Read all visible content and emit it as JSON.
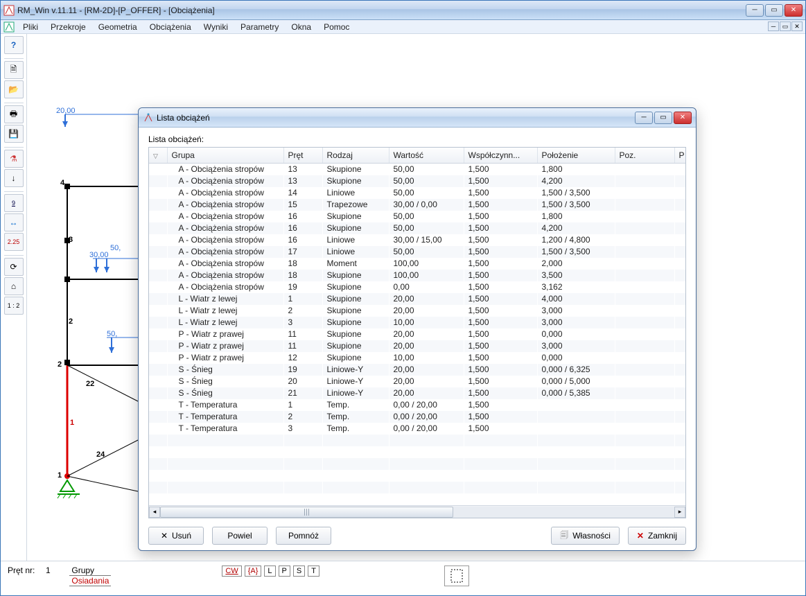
{
  "window": {
    "title": "RM_Win v.11.11 - [RM-2D]-[P_OFFER] - [Obciążenia]"
  },
  "menu": [
    "Pliki",
    "Przekroje",
    "Geometria",
    "Obciążenia",
    "Wyniki",
    "Parametry",
    "Okna",
    "Pomoc"
  ],
  "toolbar_left": {
    "help": "?",
    "num_label": "9",
    "dim_label": "2.25",
    "ratio_label": "1 : 2"
  },
  "canvas_labels": {
    "n20": "20,00",
    "n50a": "50,",
    "n30": "30,00",
    "n50b": "50,",
    "node1": "1",
    "node2": "2",
    "node3": "3",
    "node4": "4",
    "mem1": "1",
    "mem22": "22",
    "mem24": "24"
  },
  "dialog": {
    "title": "Lista obciążeń",
    "subtitle": "Lista obciążeń:",
    "columns": [
      "Grupa",
      "Pręt",
      "Rodzaj",
      "Wartość",
      "Współczynn...",
      "Położenie",
      "Poz.",
      "P"
    ],
    "rows": [
      {
        "grupa": "A - Obciążenia stropów",
        "pret": "13",
        "rodzaj": "Skupione",
        "wartosc": "50,00",
        "wsp": "1,500",
        "polozenie": "1,800",
        "poz": ""
      },
      {
        "grupa": "A - Obciążenia stropów",
        "pret": "13",
        "rodzaj": "Skupione",
        "wartosc": "50,00",
        "wsp": "1,500",
        "polozenie": "4,200",
        "poz": ""
      },
      {
        "grupa": "A - Obciążenia stropów",
        "pret": "14",
        "rodzaj": "Liniowe",
        "wartosc": "50,00",
        "wsp": "1,500",
        "polozenie": "1,500 / 3,500",
        "poz": ""
      },
      {
        "grupa": "A - Obciążenia stropów",
        "pret": "15",
        "rodzaj": "Trapezowe",
        "wartosc": "30,00 / 0,00",
        "wsp": "1,500",
        "polozenie": "1,500 / 3,500",
        "poz": ""
      },
      {
        "grupa": "A - Obciążenia stropów",
        "pret": "16",
        "rodzaj": "Skupione",
        "wartosc": "50,00",
        "wsp": "1,500",
        "polozenie": "1,800",
        "poz": ""
      },
      {
        "grupa": "A - Obciążenia stropów",
        "pret": "16",
        "rodzaj": "Skupione",
        "wartosc": "50,00",
        "wsp": "1,500",
        "polozenie": "4,200",
        "poz": ""
      },
      {
        "grupa": "A - Obciążenia stropów",
        "pret": "16",
        "rodzaj": "Liniowe",
        "wartosc": "30,00 / 15,00",
        "wsp": "1,500",
        "polozenie": "1,200 / 4,800",
        "poz": ""
      },
      {
        "grupa": "A - Obciążenia stropów",
        "pret": "17",
        "rodzaj": "Liniowe",
        "wartosc": "50,00",
        "wsp": "1,500",
        "polozenie": "1,500 / 3,500",
        "poz": ""
      },
      {
        "grupa": "A - Obciążenia stropów",
        "pret": "18",
        "rodzaj": "Moment",
        "wartosc": "100,00",
        "wsp": "1,500",
        "polozenie": "2,000",
        "poz": ""
      },
      {
        "grupa": "A - Obciążenia stropów",
        "pret": "18",
        "rodzaj": "Skupione",
        "wartosc": "100,00",
        "wsp": "1,500",
        "polozenie": "3,500",
        "poz": ""
      },
      {
        "grupa": "A - Obciążenia stropów",
        "pret": "19",
        "rodzaj": "Skupione",
        "wartosc": "0,00",
        "wsp": "1,500",
        "polozenie": "3,162",
        "poz": ""
      },
      {
        "grupa": "L - Wiatr z lewej",
        "pret": "1",
        "rodzaj": "Skupione",
        "wartosc": "20,00",
        "wsp": "1,500",
        "polozenie": "4,000",
        "poz": ""
      },
      {
        "grupa": "L - Wiatr z lewej",
        "pret": "2",
        "rodzaj": "Skupione",
        "wartosc": "20,00",
        "wsp": "1,500",
        "polozenie": "3,000",
        "poz": ""
      },
      {
        "grupa": "L - Wiatr z lewej",
        "pret": "3",
        "rodzaj": "Skupione",
        "wartosc": "10,00",
        "wsp": "1,500",
        "polozenie": "3,000",
        "poz": ""
      },
      {
        "grupa": "P - Wiatr z prawej",
        "pret": "11",
        "rodzaj": "Skupione",
        "wartosc": "20,00",
        "wsp": "1,500",
        "polozenie": "0,000",
        "poz": ""
      },
      {
        "grupa": "P - Wiatr z prawej",
        "pret": "11",
        "rodzaj": "Skupione",
        "wartosc": "20,00",
        "wsp": "1,500",
        "polozenie": "3,000",
        "poz": ""
      },
      {
        "grupa": "P - Wiatr z prawej",
        "pret": "12",
        "rodzaj": "Skupione",
        "wartosc": "10,00",
        "wsp": "1,500",
        "polozenie": "0,000",
        "poz": ""
      },
      {
        "grupa": "S - Śnieg",
        "pret": "19",
        "rodzaj": "Liniowe-Y",
        "wartosc": "20,00",
        "wsp": "1,500",
        "polozenie": "0,000 / 6,325",
        "poz": ""
      },
      {
        "grupa": "S - Śnieg",
        "pret": "20",
        "rodzaj": "Liniowe-Y",
        "wartosc": "20,00",
        "wsp": "1,500",
        "polozenie": "0,000 / 5,000",
        "poz": ""
      },
      {
        "grupa": "S - Śnieg",
        "pret": "21",
        "rodzaj": "Liniowe-Y",
        "wartosc": "20,00",
        "wsp": "1,500",
        "polozenie": "0,000 / 5,385",
        "poz": ""
      },
      {
        "grupa": "T - Temperatura",
        "pret": "1",
        "rodzaj": "Temp.",
        "wartosc": "0,00 / 20,00",
        "wsp": "1,500",
        "polozenie": "",
        "poz": ""
      },
      {
        "grupa": "T - Temperatura",
        "pret": "2",
        "rodzaj": "Temp.",
        "wartosc": "0,00 / 20,00",
        "wsp": "1,500",
        "polozenie": "",
        "poz": ""
      },
      {
        "grupa": "T - Temperatura",
        "pret": "3",
        "rodzaj": "Temp.",
        "wartosc": "0,00 / 20,00",
        "wsp": "1,500",
        "polozenie": "",
        "poz": ""
      }
    ],
    "buttons": {
      "usun": "Usuń",
      "powiel": "Powiel",
      "pomnoz": "Pomnóż",
      "wlasnosci": "Własności",
      "zamknij": "Zamknij"
    }
  },
  "status": {
    "pret_label": "Pręt nr:",
    "pret_value": "1",
    "grupy": "Grupy",
    "osiadania": "Osiadania",
    "tabs": [
      "CW",
      "{A}",
      "L",
      "P",
      "S",
      "T"
    ]
  }
}
